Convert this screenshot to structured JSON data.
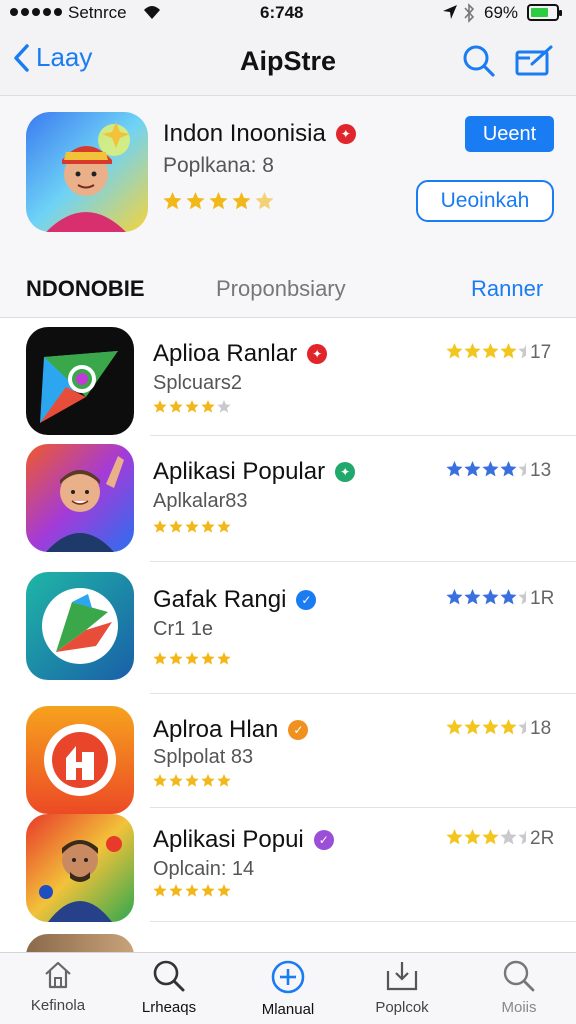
{
  "status_bar": {
    "carrier": "Setnrce",
    "time": "6:748",
    "battery": "69%",
    "battery_level": 0.69
  },
  "nav": {
    "back_label": "Laay",
    "title": "AipStre",
    "icons": [
      "search-icon",
      "compose-icon"
    ]
  },
  "featured": {
    "title": "Indon Inoonisia",
    "subtitle": "Poplkana: 8",
    "rating": 4.5,
    "primary_button": "Ueent",
    "secondary_button": "Ueoinkah",
    "colors": {
      "accent": "#1a7cf2",
      "badge": "#e0262b"
    }
  },
  "tabs": [
    {
      "label": "NDONOBIE"
    },
    {
      "label": "Proponbsiary"
    },
    {
      "label": "Ranner"
    }
  ],
  "apps": [
    {
      "name": "Aplioa Ranlar",
      "subtitle": "Splcuars2",
      "stars": 4,
      "rating_text": "17",
      "rating_stars": 4,
      "badge_color": "#e0262b",
      "rating_color": "#f2c61f"
    },
    {
      "name": "Aplikasi Popular",
      "subtitle": "Aplkalar83",
      "stars": 5,
      "rating_text": "13",
      "rating_stars": 4,
      "badge_color": "#21a86b",
      "rating_color": "#3a6fe0"
    },
    {
      "name": "Gafak Rangi",
      "subtitle": "Cr1 1e",
      "stars": 5,
      "rating_text": "1R",
      "rating_stars": 4,
      "badge_color": "#1a7cf2",
      "rating_color": "#3a6fe0"
    },
    {
      "name": "Aplroa Hlan",
      "subtitle": "Splpolat 83",
      "stars": 5,
      "rating_text": "18",
      "rating_stars": 4,
      "badge_color": "#f0901e",
      "rating_color": "#f2c61f"
    },
    {
      "name": "Aplikasi Popui",
      "subtitle": "Oplcain: 14",
      "stars": 5,
      "rating_text": "2R",
      "rating_stars": 3,
      "badge_color": "#9b4fd6",
      "rating_color": "#f2c61f"
    }
  ],
  "tab_bar": [
    {
      "label": "Kefinola",
      "icon": "home-icon"
    },
    {
      "label": "Lrheaqs",
      "icon": "search-icon"
    },
    {
      "label": "Mlanual",
      "icon": "add-circle-icon"
    },
    {
      "label": "Poplcok",
      "icon": "download-tray-icon"
    },
    {
      "label": "Moiis",
      "icon": "search-icon"
    }
  ]
}
